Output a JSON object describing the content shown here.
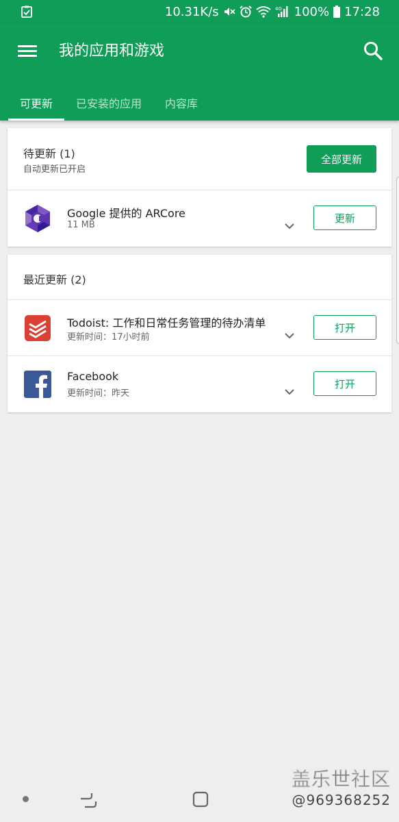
{
  "status_bar": {
    "speed": "10.31K/s",
    "network": "4G",
    "battery": "100%",
    "time": "17:28"
  },
  "app_bar": {
    "title": "我的应用和游戏",
    "tabs": [
      {
        "label": "可更新",
        "active": true
      },
      {
        "label": "已安装的应用",
        "active": false
      },
      {
        "label": "内容库",
        "active": false
      }
    ]
  },
  "pending_card": {
    "title": "待更新 (1)",
    "subtitle": "自动更新已开启",
    "update_all_label": "全部更新",
    "apps": [
      {
        "name": "Google 提供的 ARCore",
        "meta": "11 MB",
        "action": "更新",
        "icon": "arcore-icon"
      }
    ]
  },
  "recent_card": {
    "title": "最近更新 (2)",
    "apps": [
      {
        "name": "Todoist: 工作和日常任务管理的待办清单",
        "meta": "更新时间：17小时前",
        "action": "打开",
        "icon": "todoist-icon"
      },
      {
        "name": "Facebook",
        "meta": "更新时间：昨天",
        "action": "打开",
        "icon": "facebook-icon"
      }
    ]
  },
  "watermark": {
    "title": "盖乐世社区",
    "handle": "@969368252"
  },
  "colors": {
    "brand_green": "#0f9d58",
    "background": "#eeeeee",
    "todoist_red": "#db4035",
    "facebook_blue": "#3b5998"
  }
}
